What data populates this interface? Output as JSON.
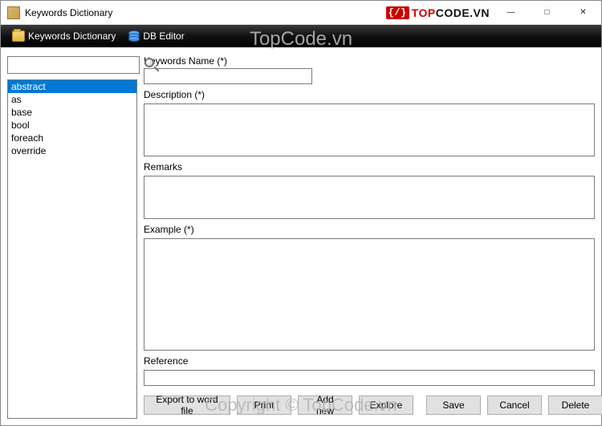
{
  "window": {
    "title": "Keywords Dictionary",
    "logo_text_1": "TOP",
    "logo_text_2": "CODE.VN"
  },
  "toolbar": {
    "dictionary_label": "Keywords Dictionary",
    "dbeditor_label": "DB Editor"
  },
  "watermark": {
    "top": "TopCode.vn",
    "bottom": "Copyright © TopCode.vn"
  },
  "search": {
    "value": ""
  },
  "keywords": {
    "items": [
      "abstract",
      "as",
      "base",
      "bool",
      "foreach",
      "override"
    ],
    "selected_index": 0
  },
  "form": {
    "labels": {
      "name": "Keywords Name (*)",
      "description": "Description (*)",
      "remarks": "Remarks",
      "example": "Example (*)",
      "reference": "Reference"
    },
    "values": {
      "name": "",
      "description": "",
      "remarks": "",
      "example": "",
      "reference": ""
    }
  },
  "buttons": {
    "export": "Export to word file",
    "print": "Print",
    "addnew": "Add new",
    "explore": "Explore",
    "save": "Save",
    "cancel": "Cancel",
    "delete": "Delete"
  }
}
